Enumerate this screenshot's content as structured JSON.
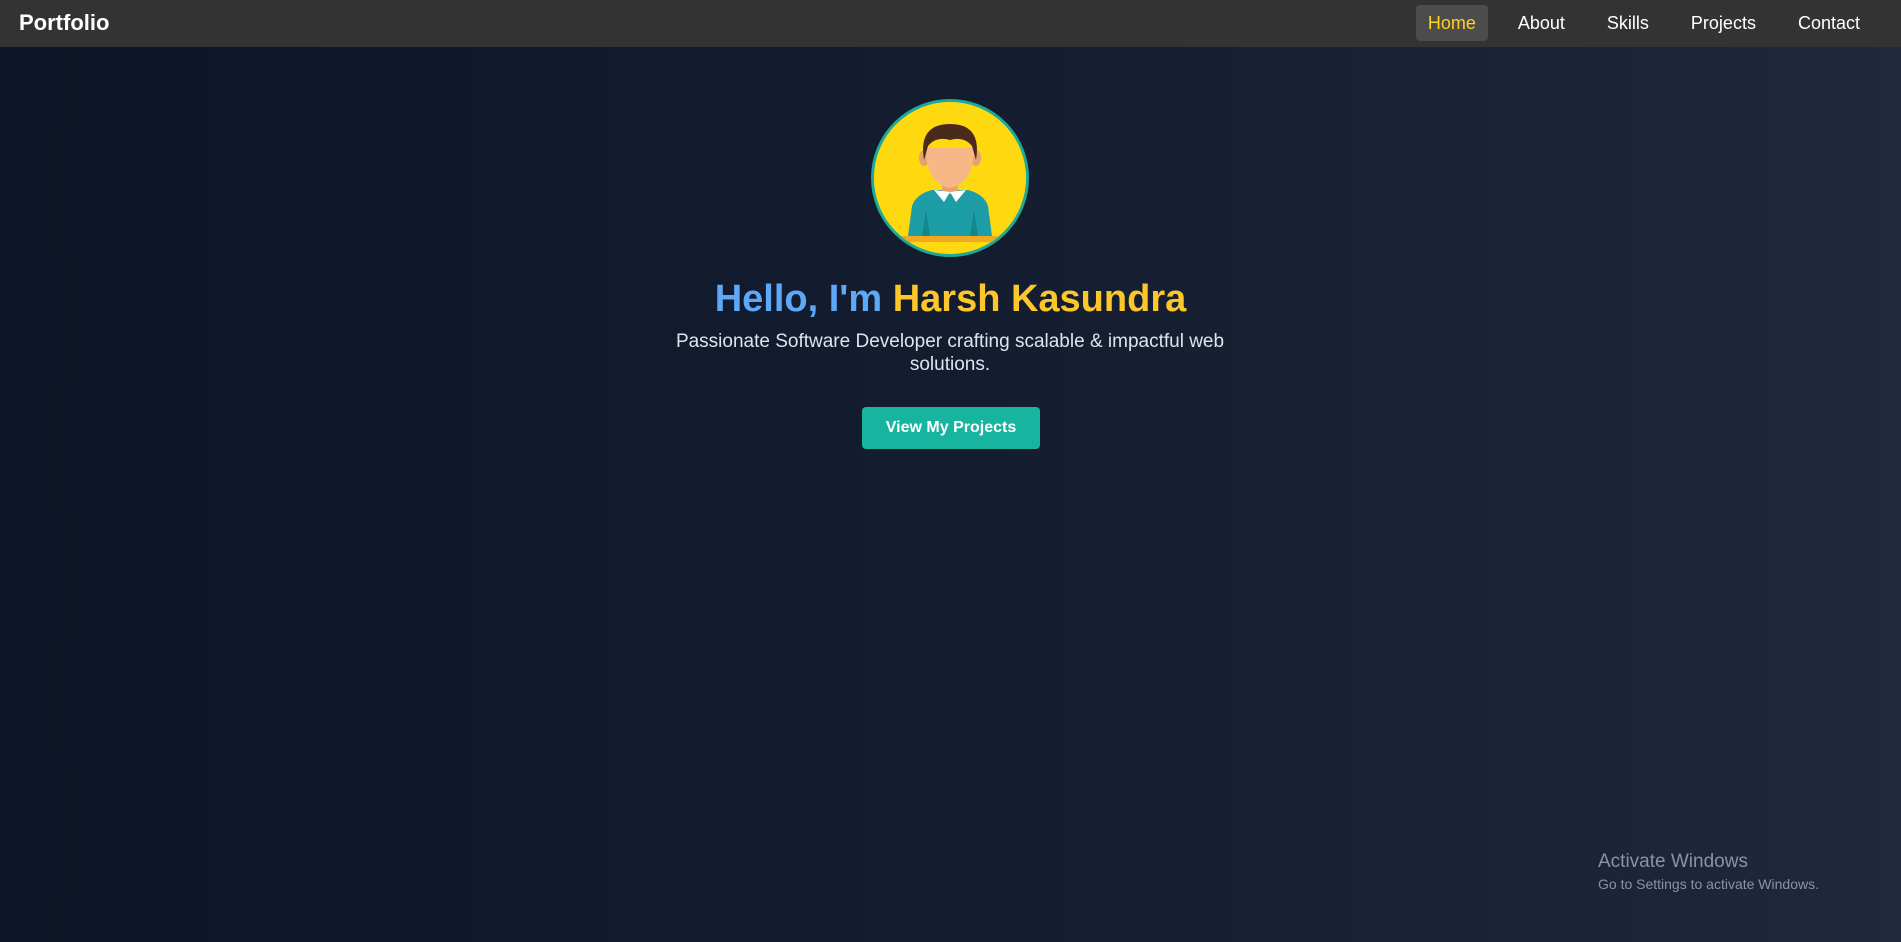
{
  "nav": {
    "brand": "Portfolio",
    "links": [
      "Home",
      "About",
      "Skills",
      "Projects",
      "Contact"
    ],
    "active": "Home"
  },
  "hero": {
    "greeting": "Hello, I'm",
    "name": "Harsh Kasundra",
    "tagline": "Passionate Software Developer crafting scalable & impactful web solutions.",
    "cta_label": "View My Projects",
    "avatar_icon": "user-avatar-icon"
  },
  "watermark": {
    "title": "Activate Windows",
    "subtitle": "Go to Settings to activate Windows."
  },
  "colors": {
    "navbar": "#333333",
    "accent_yellow": "#fcc72a",
    "accent_blue": "#5ea8f8",
    "button_teal": "#17b4a0"
  }
}
